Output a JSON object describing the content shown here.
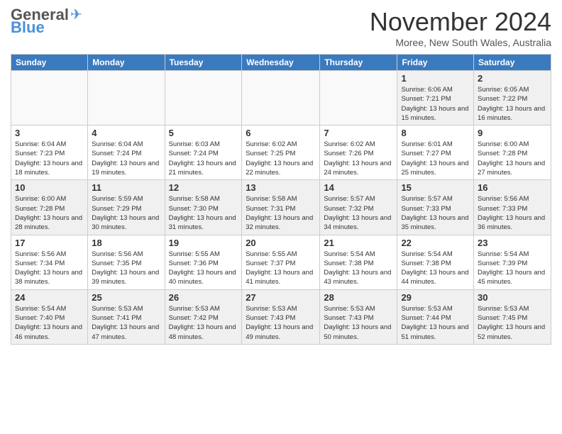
{
  "header": {
    "logo_general": "General",
    "logo_blue": "Blue",
    "month_title": "November 2024",
    "location": "Moree, New South Wales, Australia"
  },
  "weekdays": [
    "Sunday",
    "Monday",
    "Tuesday",
    "Wednesday",
    "Thursday",
    "Friday",
    "Saturday"
  ],
  "weeks": [
    [
      {
        "day": "",
        "info": ""
      },
      {
        "day": "",
        "info": ""
      },
      {
        "day": "",
        "info": ""
      },
      {
        "day": "",
        "info": ""
      },
      {
        "day": "",
        "info": ""
      },
      {
        "day": "1",
        "info": "Sunrise: 6:06 AM\nSunset: 7:21 PM\nDaylight: 13 hours and 15 minutes."
      },
      {
        "day": "2",
        "info": "Sunrise: 6:05 AM\nSunset: 7:22 PM\nDaylight: 13 hours and 16 minutes."
      }
    ],
    [
      {
        "day": "3",
        "info": "Sunrise: 6:04 AM\nSunset: 7:23 PM\nDaylight: 13 hours and 18 minutes."
      },
      {
        "day": "4",
        "info": "Sunrise: 6:04 AM\nSunset: 7:24 PM\nDaylight: 13 hours and 19 minutes."
      },
      {
        "day": "5",
        "info": "Sunrise: 6:03 AM\nSunset: 7:24 PM\nDaylight: 13 hours and 21 minutes."
      },
      {
        "day": "6",
        "info": "Sunrise: 6:02 AM\nSunset: 7:25 PM\nDaylight: 13 hours and 22 minutes."
      },
      {
        "day": "7",
        "info": "Sunrise: 6:02 AM\nSunset: 7:26 PM\nDaylight: 13 hours and 24 minutes."
      },
      {
        "day": "8",
        "info": "Sunrise: 6:01 AM\nSunset: 7:27 PM\nDaylight: 13 hours and 25 minutes."
      },
      {
        "day": "9",
        "info": "Sunrise: 6:00 AM\nSunset: 7:28 PM\nDaylight: 13 hours and 27 minutes."
      }
    ],
    [
      {
        "day": "10",
        "info": "Sunrise: 6:00 AM\nSunset: 7:28 PM\nDaylight: 13 hours and 28 minutes."
      },
      {
        "day": "11",
        "info": "Sunrise: 5:59 AM\nSunset: 7:29 PM\nDaylight: 13 hours and 30 minutes."
      },
      {
        "day": "12",
        "info": "Sunrise: 5:58 AM\nSunset: 7:30 PM\nDaylight: 13 hours and 31 minutes."
      },
      {
        "day": "13",
        "info": "Sunrise: 5:58 AM\nSunset: 7:31 PM\nDaylight: 13 hours and 32 minutes."
      },
      {
        "day": "14",
        "info": "Sunrise: 5:57 AM\nSunset: 7:32 PM\nDaylight: 13 hours and 34 minutes."
      },
      {
        "day": "15",
        "info": "Sunrise: 5:57 AM\nSunset: 7:33 PM\nDaylight: 13 hours and 35 minutes."
      },
      {
        "day": "16",
        "info": "Sunrise: 5:56 AM\nSunset: 7:33 PM\nDaylight: 13 hours and 36 minutes."
      }
    ],
    [
      {
        "day": "17",
        "info": "Sunrise: 5:56 AM\nSunset: 7:34 PM\nDaylight: 13 hours and 38 minutes."
      },
      {
        "day": "18",
        "info": "Sunrise: 5:56 AM\nSunset: 7:35 PM\nDaylight: 13 hours and 39 minutes."
      },
      {
        "day": "19",
        "info": "Sunrise: 5:55 AM\nSunset: 7:36 PM\nDaylight: 13 hours and 40 minutes."
      },
      {
        "day": "20",
        "info": "Sunrise: 5:55 AM\nSunset: 7:37 PM\nDaylight: 13 hours and 41 minutes."
      },
      {
        "day": "21",
        "info": "Sunrise: 5:54 AM\nSunset: 7:38 PM\nDaylight: 13 hours and 43 minutes."
      },
      {
        "day": "22",
        "info": "Sunrise: 5:54 AM\nSunset: 7:38 PM\nDaylight: 13 hours and 44 minutes."
      },
      {
        "day": "23",
        "info": "Sunrise: 5:54 AM\nSunset: 7:39 PM\nDaylight: 13 hours and 45 minutes."
      }
    ],
    [
      {
        "day": "24",
        "info": "Sunrise: 5:54 AM\nSunset: 7:40 PM\nDaylight: 13 hours and 46 minutes."
      },
      {
        "day": "25",
        "info": "Sunrise: 5:53 AM\nSunset: 7:41 PM\nDaylight: 13 hours and 47 minutes."
      },
      {
        "day": "26",
        "info": "Sunrise: 5:53 AM\nSunset: 7:42 PM\nDaylight: 13 hours and 48 minutes."
      },
      {
        "day": "27",
        "info": "Sunrise: 5:53 AM\nSunset: 7:43 PM\nDaylight: 13 hours and 49 minutes."
      },
      {
        "day": "28",
        "info": "Sunrise: 5:53 AM\nSunset: 7:43 PM\nDaylight: 13 hours and 50 minutes."
      },
      {
        "day": "29",
        "info": "Sunrise: 5:53 AM\nSunset: 7:44 PM\nDaylight: 13 hours and 51 minutes."
      },
      {
        "day": "30",
        "info": "Sunrise: 5:53 AM\nSunset: 7:45 PM\nDaylight: 13 hours and 52 minutes."
      }
    ]
  ]
}
